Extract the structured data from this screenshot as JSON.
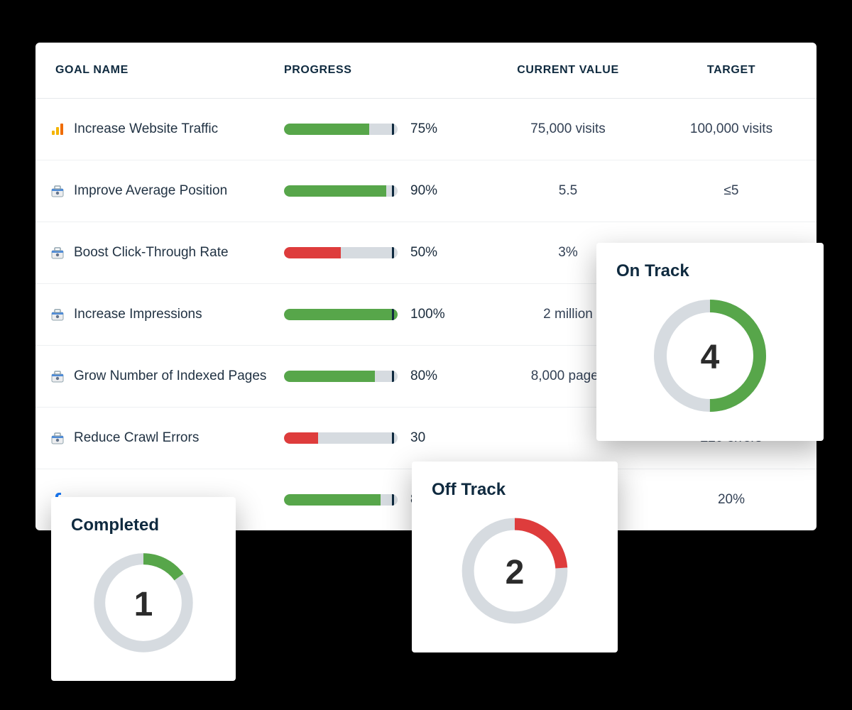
{
  "columns": {
    "name": "GOAL NAME",
    "progress": "PROGRESS",
    "current": "CURRENT VALUE",
    "target": "TARGET"
  },
  "rows": [
    {
      "icon": "analytics",
      "name": "Increase Website Traffic",
      "progress": 75,
      "label": "75%",
      "color": "#57a64a",
      "current": "75,000 visits",
      "target": "100,000 visits"
    },
    {
      "icon": "toolbox",
      "name": "Improve Average Position",
      "progress": 90,
      "label": "90%",
      "color": "#57a64a",
      "current": "5.5",
      "target": "≤5"
    },
    {
      "icon": "toolbox",
      "name": "Boost Click-Through Rate",
      "progress": 50,
      "label": "50%",
      "color": "#de3c3c",
      "current": "3%",
      "target": ""
    },
    {
      "icon": "toolbox",
      "name": "Increase Impressions",
      "progress": 100,
      "label": "100%",
      "color": "#57a64a",
      "current": "2 million",
      "target": ""
    },
    {
      "icon": "toolbox",
      "name": "Grow Number of Indexed Pages",
      "progress": 80,
      "label": "80%",
      "color": "#57a64a",
      "current": "8,000 pages",
      "target": ""
    },
    {
      "icon": "toolbox",
      "name": "Reduce Crawl Errors",
      "progress": 30,
      "label": "30",
      "color": "#de3c3c",
      "current": "",
      "target": "≤20 errors"
    },
    {
      "icon": "facebook",
      "name": "",
      "progress": 85,
      "label": "85",
      "color": "#57a64a",
      "current": "",
      "target": "20%"
    }
  ],
  "cards": {
    "ontrack": {
      "title": "On Track",
      "value": "4",
      "color": "#57a64a",
      "pct": 50
    },
    "offtrack": {
      "title": "Off Track",
      "value": "2",
      "color": "#de3c3c",
      "pct": 24
    },
    "completed": {
      "title": "Completed",
      "value": "1",
      "color": "#57a64a",
      "pct": 15
    }
  }
}
